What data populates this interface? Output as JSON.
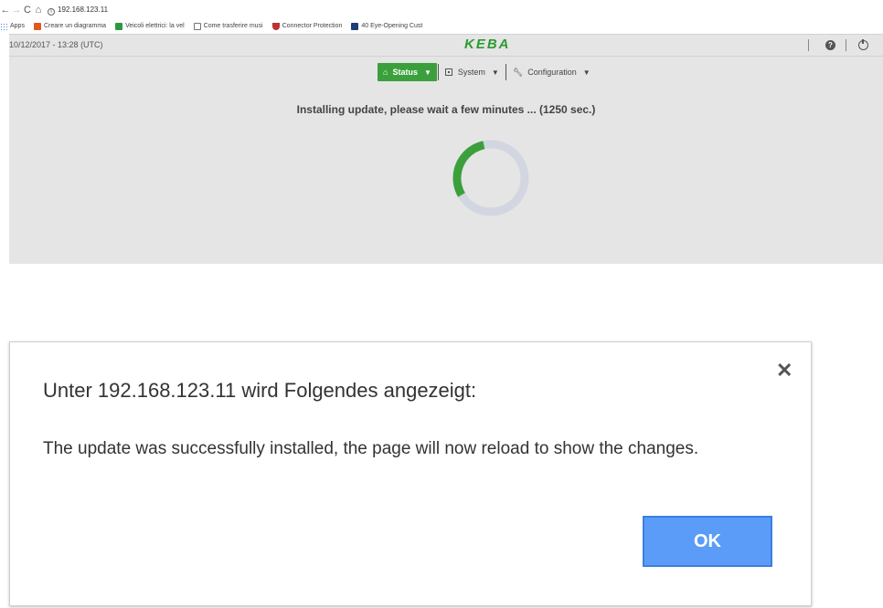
{
  "browser": {
    "url": "192.168.123.11",
    "bookmarks": [
      {
        "label": "Apps",
        "icon": "apps-grid-icon"
      },
      {
        "label": "Creare un diagramma",
        "icon": "office-icon"
      },
      {
        "label": "Veicoli elettrici: la vel",
        "icon": "bookmark-favicon-icon"
      },
      {
        "label": "Come trasferire musi",
        "icon": "document-icon"
      },
      {
        "label": "Connector Protection",
        "icon": "shield-favicon-icon"
      },
      {
        "label": "40 Eye-Opening Cust",
        "icon": "facebook-favicon-icon"
      }
    ]
  },
  "app": {
    "datetime": "10/12/2017 - 13:28 (UTC)",
    "logo": "KEBA",
    "menu": {
      "status": "Status",
      "system": "System",
      "configuration": "Configuration"
    },
    "install_message": "Installing update, please wait a few minutes ... (1250 sec.)",
    "spinner": {
      "progress": 0.3,
      "color_arc": "#3ba03b",
      "color_track": "#d2d6e0"
    }
  },
  "dialog": {
    "title": "Unter 192.168.123.11 wird Folgendes angezeigt:",
    "message": "The update was successfully installed, the page will now reload to show the changes.",
    "ok_label": "OK",
    "close_glyph": "✕"
  },
  "colors": {
    "accent_green": "#3ba03b",
    "button_blue": "#5a9cf8"
  }
}
